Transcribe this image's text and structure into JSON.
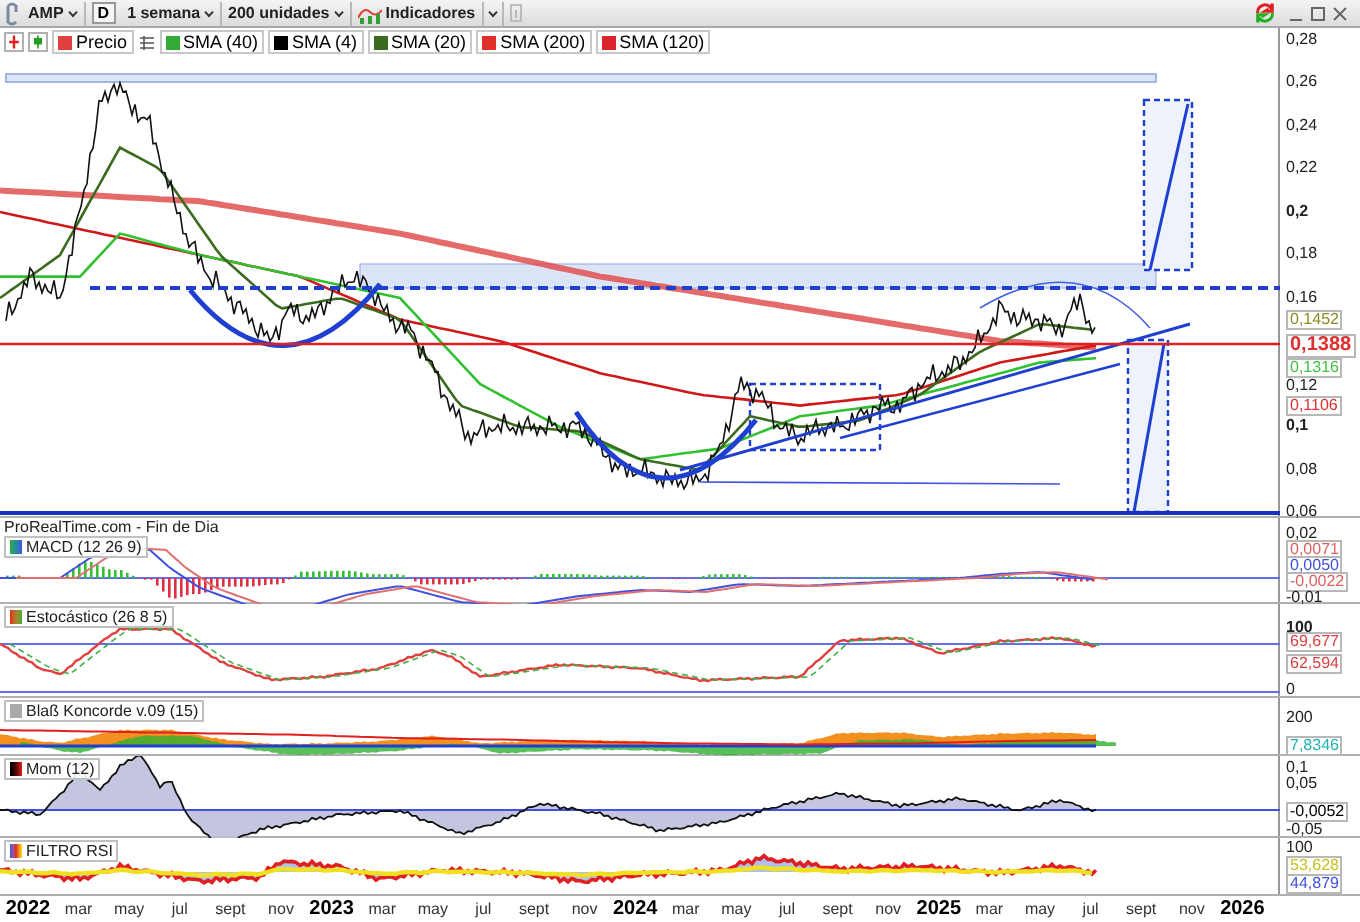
{
  "toolbar": {
    "symbol": "AMP",
    "period_button": "D",
    "timeframe": "1 semana",
    "units": "200 unidades",
    "indicators": "Indicadores"
  },
  "legend": [
    {
      "label": "Precio",
      "color": "#e04040"
    },
    {
      "label": "SMA (40)",
      "color": "#33aa33"
    },
    {
      "label": "SMA (4)",
      "color": "#000000"
    },
    {
      "label": "SMA (20)",
      "color": "#3b6b1e"
    },
    {
      "label": "SMA (200)",
      "color": "#e0302a"
    },
    {
      "label": "SMA (120)",
      "color": "#d8262c"
    }
  ],
  "price_axis": {
    "ticks": [
      {
        "label": "0,28",
        "bold": false
      },
      {
        "label": "0,26",
        "bold": false
      },
      {
        "label": "0,24",
        "bold": false
      },
      {
        "label": "0,22",
        "bold": false
      },
      {
        "label": "0,2",
        "bold": true
      },
      {
        "label": "0,18",
        "bold": false
      },
      {
        "label": "0,16",
        "bold": false
      },
      {
        "label": "0,12",
        "bold": false
      },
      {
        "label": "0,1",
        "bold": true
      },
      {
        "label": "0,08",
        "bold": false
      },
      {
        "label": "0,06",
        "bold": false
      }
    ],
    "markers": [
      {
        "label": "0,1452",
        "color": "#8a8a20"
      },
      {
        "label": "0,1388",
        "color": "#e03030"
      },
      {
        "label": "0,1316",
        "color": "#40c040"
      },
      {
        "label": "0,1106",
        "color": "#e03030"
      }
    ]
  },
  "source": "ProRealTime.com - Fin de Dia",
  "panels": [
    {
      "title": "MACD (12 26 9)",
      "labels": [
        {
          "label": "0,02",
          "kind": "tick",
          "bold": false
        },
        {
          "label": "0,0071",
          "kind": "value",
          "color": "#e06060"
        },
        {
          "label": "0,0050",
          "kind": "value",
          "color": "#4050e0"
        },
        {
          "label": "-0,0022",
          "kind": "value",
          "color": "#e06060"
        },
        {
          "label": "-0,01",
          "kind": "tick",
          "bold": false
        }
      ]
    },
    {
      "title": "Estocástico (26 8 5)",
      "labels": [
        {
          "label": "100",
          "kind": "tick",
          "bold": true
        },
        {
          "label": "69,677",
          "kind": "value",
          "color": "#e04040"
        },
        {
          "label": "62,594",
          "kind": "value",
          "color": "#e04040"
        },
        {
          "label": "0",
          "kind": "tick",
          "bold": false
        }
      ]
    },
    {
      "title": "Blaß Koncorde v.09 (15)",
      "labels": [
        {
          "label": "200",
          "kind": "tick",
          "bold": false
        },
        {
          "label": "7,8346",
          "kind": "value",
          "color": "#20b0b0"
        }
      ]
    },
    {
      "title": "Mom (12)",
      "labels": [
        {
          "label": "0,1",
          "kind": "tick",
          "bold": false
        },
        {
          "label": "0,05",
          "kind": "tick",
          "bold": false
        },
        {
          "label": "-0,0052",
          "kind": "value",
          "color": "#000000"
        },
        {
          "label": "-0,05",
          "kind": "tick",
          "bold": false
        }
      ]
    },
    {
      "title": "FILTRO RSI",
      "labels": [
        {
          "label": "100",
          "kind": "tick",
          "bold": false
        },
        {
          "label": "53,628",
          "kind": "value",
          "color": "#c8c020"
        },
        {
          "label": "44,879",
          "kind": "value",
          "color": "#4050e0"
        }
      ]
    }
  ],
  "x_axis": [
    {
      "label": "2022",
      "kind": "year"
    },
    {
      "label": "mar",
      "kind": "month"
    },
    {
      "label": "may",
      "kind": "month"
    },
    {
      "label": "jul",
      "kind": "month"
    },
    {
      "label": "sept",
      "kind": "month"
    },
    {
      "label": "nov",
      "kind": "month"
    },
    {
      "label": "2023",
      "kind": "year"
    },
    {
      "label": "mar",
      "kind": "month"
    },
    {
      "label": "may",
      "kind": "month"
    },
    {
      "label": "jul",
      "kind": "month"
    },
    {
      "label": "sept",
      "kind": "month"
    },
    {
      "label": "nov",
      "kind": "month"
    },
    {
      "label": "2024",
      "kind": "year"
    },
    {
      "label": "mar",
      "kind": "month"
    },
    {
      "label": "may",
      "kind": "month"
    },
    {
      "label": "jul",
      "kind": "month"
    },
    {
      "label": "sept",
      "kind": "month"
    },
    {
      "label": "nov",
      "kind": "month"
    },
    {
      "label": "2025",
      "kind": "year"
    },
    {
      "label": "mar",
      "kind": "month"
    },
    {
      "label": "may",
      "kind": "month"
    },
    {
      "label": "jul",
      "kind": "month"
    },
    {
      "label": "sept",
      "kind": "month"
    },
    {
      "label": "nov",
      "kind": "month"
    },
    {
      "label": "2026",
      "kind": "year"
    }
  ]
}
